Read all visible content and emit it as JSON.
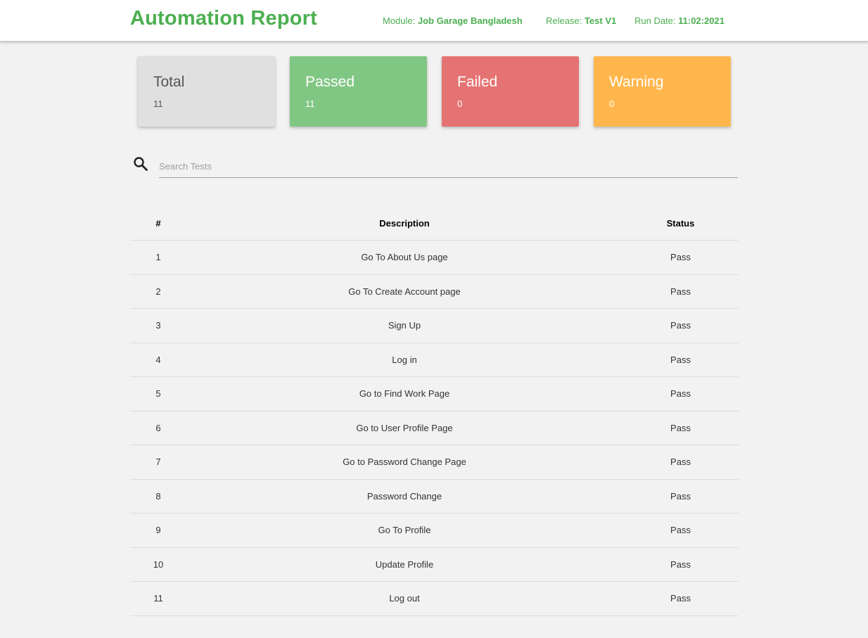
{
  "header": {
    "title": "Automation Report",
    "module_label": "Module:",
    "module_value": "Job Garage Bangladesh",
    "release_label": "Release:",
    "release_value": "Test V1",
    "run_date_label": "Run Date:",
    "run_date_value": "11:02:2021"
  },
  "summary": {
    "total": {
      "label": "Total",
      "count": "11"
    },
    "passed": {
      "label": "Passed",
      "count": "11"
    },
    "failed": {
      "label": "Failed",
      "count": "0"
    },
    "warning": {
      "label": "Warning",
      "count": "0"
    }
  },
  "colors": {
    "accent": "#4caf50",
    "total_card": "#e0e0e0",
    "passed_card": "#81c784",
    "failed_card": "#e57373",
    "warning_card": "#ffb74d"
  },
  "search": {
    "icon": "search-icon",
    "placeholder": "Search Tests",
    "value": ""
  },
  "table": {
    "headers": {
      "num": "#",
      "description": "Description",
      "status": "Status"
    },
    "rows": [
      {
        "num": "1",
        "description": "Go To About Us page",
        "status": "Pass"
      },
      {
        "num": "2",
        "description": "Go To Create Account page",
        "status": "Pass"
      },
      {
        "num": "3",
        "description": "Sign Up",
        "status": "Pass"
      },
      {
        "num": "4",
        "description": "Log in",
        "status": "Pass"
      },
      {
        "num": "5",
        "description": "Go to Find Work Page",
        "status": "Pass"
      },
      {
        "num": "6",
        "description": "Go to User Profile Page",
        "status": "Pass"
      },
      {
        "num": "7",
        "description": "Go to Password Change Page",
        "status": "Pass"
      },
      {
        "num": "8",
        "description": "Password Change",
        "status": "Pass"
      },
      {
        "num": "9",
        "description": "Go To Profile",
        "status": "Pass"
      },
      {
        "num": "10",
        "description": "Update Profile",
        "status": "Pass"
      },
      {
        "num": "11",
        "description": "Log out",
        "status": "Pass"
      }
    ]
  }
}
